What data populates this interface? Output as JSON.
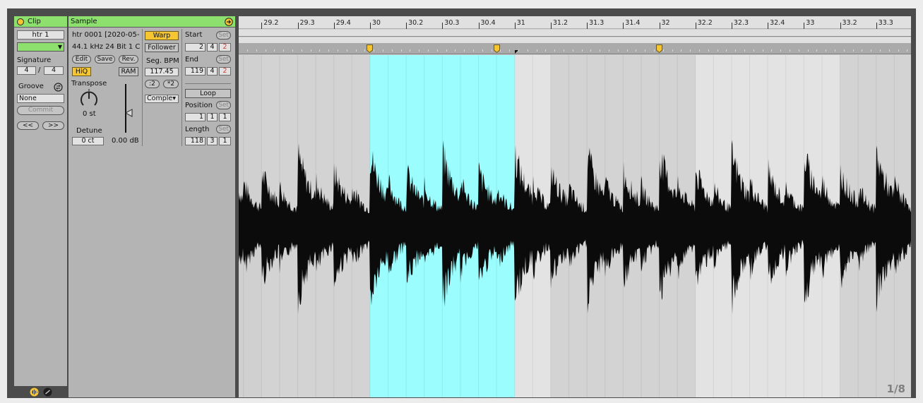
{
  "clip": {
    "title": "Clip",
    "name": "htr 1",
    "signature_label": "Signature",
    "signature_num": "4",
    "signature_sep": "/",
    "signature_den": "4",
    "groove_label": "Groove",
    "groove_value": "None",
    "commit_label": "Commit",
    "prev_label": "<<",
    "next_label": ">>",
    "color": "#8ee06e"
  },
  "sample": {
    "title": "Sample",
    "file_name": "htr 0001 [2020-05-2",
    "file_info": "44.1 kHz 24 Bit 1 Ch",
    "edit_label": "Edit",
    "save_label": "Save",
    "rev_label": "Rev.",
    "hiq_label": "HiQ",
    "ram_label": "RAM",
    "transpose_label": "Transpose",
    "transpose_value": "0 st",
    "detune_label": "Detune",
    "detune_value": "0 ct",
    "gain_value": "0.00 dB",
    "warp_label": "Warp",
    "follower_label": "Follower",
    "segbpm_label": "Seg. BPM",
    "segbpm_value": "117.45",
    "half_label": ":2",
    "double_label": "*2",
    "warp_mode": "Comple▾",
    "start_label": "Start",
    "start_values": [
      "2",
      "4",
      "2"
    ],
    "end_label": "End",
    "end_values": [
      "119",
      "4",
      "2"
    ],
    "set_label": "Set",
    "loop_label": "Loop",
    "position_label": "Position",
    "position_values": [
      "1",
      "1",
      "1"
    ],
    "length_label": "Length",
    "length_values": [
      "118",
      "3",
      "1"
    ]
  },
  "timeline": {
    "ruler_labels": [
      "29.2",
      "29.3",
      "29.4",
      "30",
      "30.2",
      "30.3",
      "30.4",
      "31",
      "31.2",
      "31.3",
      "31.4",
      "32",
      "32.2",
      "32.3",
      "32.4",
      "33",
      "33.2",
      "33.3"
    ],
    "page_indicator": "1/8",
    "selection_color": "#9bfdfd",
    "marker_color": "#f5c632"
  }
}
